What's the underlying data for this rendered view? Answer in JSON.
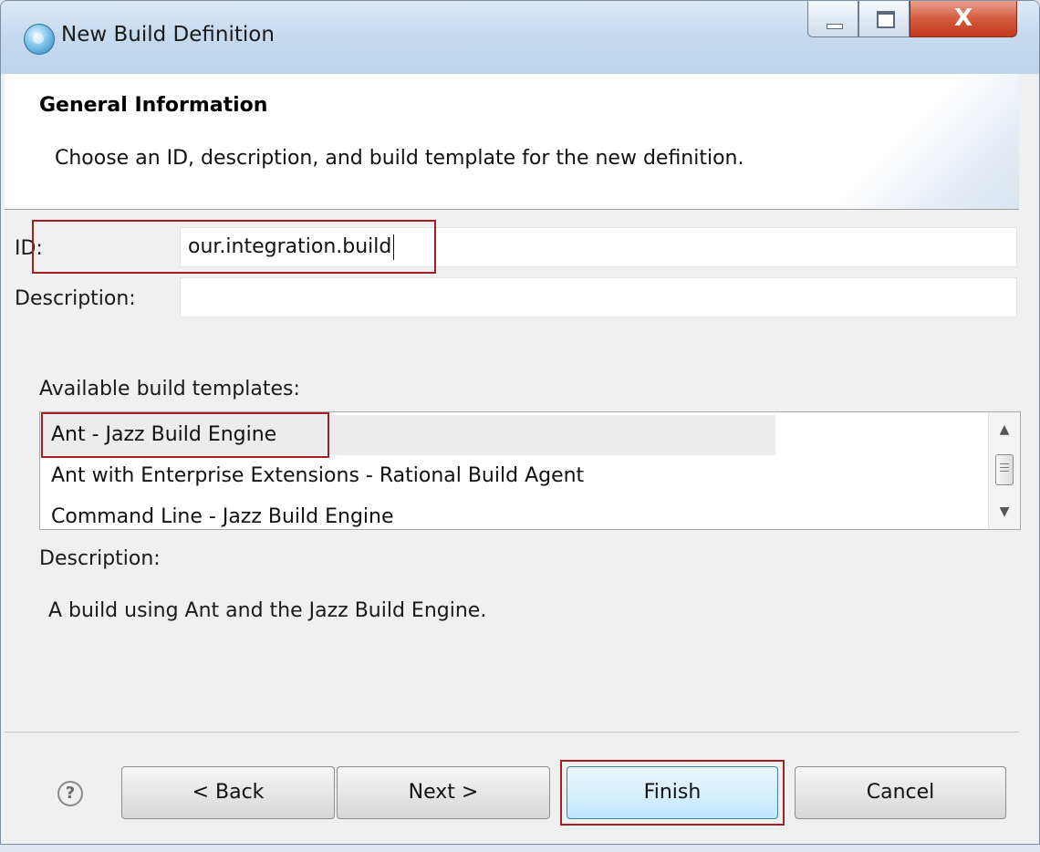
{
  "window": {
    "title": "New Build Definition",
    "close_glyph": "X"
  },
  "header": {
    "title": "General Information",
    "description": "Choose an ID, description, and build template for the new definition."
  },
  "form": {
    "id_label": "ID:",
    "id_value": "our.integration.build",
    "description_label": "Description:",
    "description_value": "",
    "templates_label": "Available build templates:",
    "templates": [
      "Ant - Jazz Build Engine",
      "Ant with Enterprise Extensions - Rational Build Agent",
      "Command Line - Jazz Build Engine"
    ],
    "selected_template_index": 0,
    "template_description_label": "Description:",
    "template_description": "A build using Ant and the Jazz Build Engine."
  },
  "footer": {
    "help_glyph": "?",
    "back_label": "< Back",
    "next_label": "Next >",
    "finish_label": "Finish",
    "cancel_label": "Cancel"
  },
  "colors": {
    "highlight": "#a41e22",
    "primary_button": "#bee6fd"
  }
}
